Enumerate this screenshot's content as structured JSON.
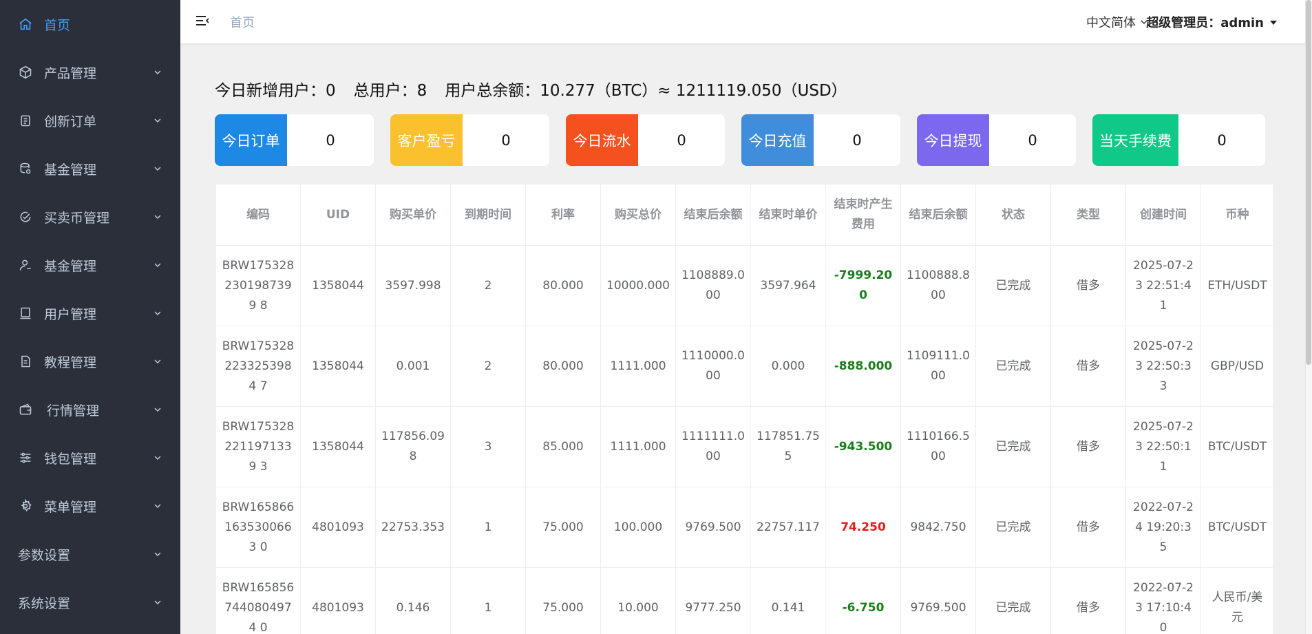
{
  "sidebar": {
    "items": [
      {
        "label": "首页",
        "icon": "home-icon"
      },
      {
        "label": "产品管理",
        "icon": "cube-icon"
      },
      {
        "label": "创新订单",
        "icon": "clipboard-icon"
      },
      {
        "label": "基金管理",
        "icon": "database-icon"
      },
      {
        "label": "买卖币管理",
        "icon": "check-circle-icon"
      },
      {
        "label": "基金管理",
        "icon": "user-icon"
      },
      {
        "label": "用户管理",
        "icon": "monitor-icon"
      },
      {
        "label": "教程管理",
        "icon": "document-icon"
      },
      {
        "label": "行情管理",
        "icon": "wallet-icon"
      },
      {
        "label": "钱包管理",
        "icon": "sliders-icon"
      },
      {
        "label": "菜单管理",
        "icon": "gear-icon"
      },
      {
        "label": "参数设置",
        "icon": ""
      },
      {
        "label": "系统设置",
        "icon": ""
      }
    ]
  },
  "header": {
    "breadcrumb": "首页",
    "language": "中文简体",
    "user": "超级管理员：admin"
  },
  "summary": {
    "new_users": "今日新增用户：0",
    "total_users": "总用户：8",
    "balance": "用户总余额：10.277（BTC）≈ 1211119.050（USD）"
  },
  "cards": [
    {
      "label": "今日订单",
      "value": "0",
      "color": "#1e88e5"
    },
    {
      "label": "客户盈亏",
      "value": "0",
      "color": "#fbc02d"
    },
    {
      "label": "今日流水",
      "value": "0",
      "color": "#f4511e"
    },
    {
      "label": "今日充值",
      "value": "0",
      "color": "#3f8ddb"
    },
    {
      "label": "今日提现",
      "value": "0",
      "color": "#7b68ee"
    },
    {
      "label": "当天手续费",
      "value": "0",
      "color": "#10c887"
    }
  ],
  "table": {
    "headers": [
      "编码",
      "UID",
      "购买单价",
      "到期时间",
      "利率",
      "购买总价",
      "结束后余额",
      "结束时单价",
      "结束时产生费用",
      "结束后余额",
      "状态",
      "类型",
      "创建时间",
      "币种"
    ],
    "rows": [
      [
        "BRW1753282301987399 8",
        "1358044",
        "3597.998",
        "2",
        "80.000",
        "10000.000",
        "1108889.000",
        "3597.964",
        "-7999.200",
        "1100888.800",
        "已完成",
        "借多",
        "2025-07-23 22:51:41",
        "ETH/USDT"
      ],
      [
        "BRW1753282233253984 7",
        "1358044",
        "0.001",
        "2",
        "80.000",
        "1111.000",
        "1110000.000",
        "0.000",
        "-888.000",
        "1109111.000",
        "已完成",
        "借多",
        "2025-07-23 22:50:33",
        "GBP/USD"
      ],
      [
        "BRW1753282211971339 3",
        "1358044",
        "117856.098",
        "3",
        "85.000",
        "1111.000",
        "1111111.000",
        "117851.755",
        "-943.500",
        "1110166.500",
        "已完成",
        "借多",
        "2025-07-23 22:50:11",
        "BTC/USDT"
      ],
      [
        "BRW1658661635300663 0",
        "4801093",
        "22753.353",
        "1",
        "75.000",
        "100.000",
        "9769.500",
        "22757.117",
        "74.250",
        "9842.750",
        "已完成",
        "借多",
        "2022-07-24 19:20:35",
        "BTC/USDT"
      ],
      [
        "BRW1658567440804974 0",
        "4801093",
        "0.146",
        "1",
        "75.000",
        "10.000",
        "9777.250",
        "0.141",
        "-6.750",
        "9769.500",
        "已完成",
        "借多",
        "2022-07-23 17:10:40",
        "人民币/美元"
      ]
    ]
  }
}
